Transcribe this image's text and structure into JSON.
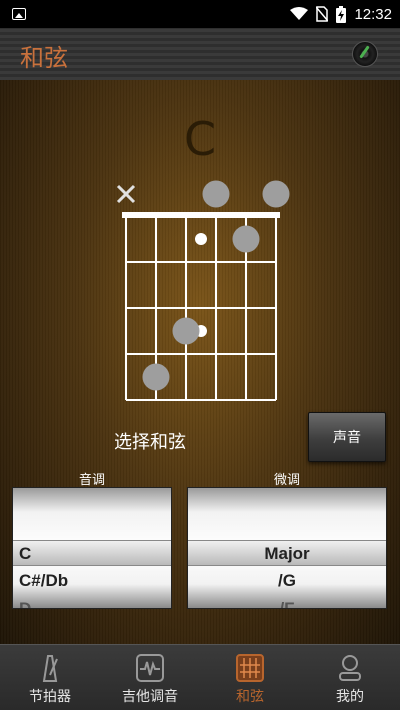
{
  "status": {
    "time": "12:32"
  },
  "header": {
    "title": "和弦"
  },
  "chord": {
    "name": "C",
    "muted_strings": [
      1
    ],
    "open_strings": [
      4,
      6
    ],
    "position_dots": [
      {
        "string": 2,
        "fret": 4
      },
      {
        "string": 3,
        "fret": 3
      },
      {
        "string": 5,
        "fret": 1
      }
    ],
    "fret_markers": [
      1,
      3
    ]
  },
  "controls": {
    "select_label": "选择和弦",
    "sound_button": "声音"
  },
  "pickers": {
    "key": {
      "title": "音调",
      "items": [
        "C",
        "C#/Db",
        "D"
      ],
      "selected": "C"
    },
    "tune": {
      "title": "微调",
      "items": [
        "Major",
        "/G",
        "/F"
      ],
      "selected": "Major"
    }
  },
  "nav": {
    "items": [
      {
        "label": "节拍器",
        "icon": "metronome-icon"
      },
      {
        "label": "吉他调音",
        "icon": "tuner-icon"
      },
      {
        "label": "和弦",
        "icon": "chord-grid-icon"
      },
      {
        "label": "我的",
        "icon": "profile-icon"
      }
    ],
    "active": "和弦"
  },
  "colors": {
    "accent": "#c9713c",
    "active_nav": "#b8652d"
  }
}
